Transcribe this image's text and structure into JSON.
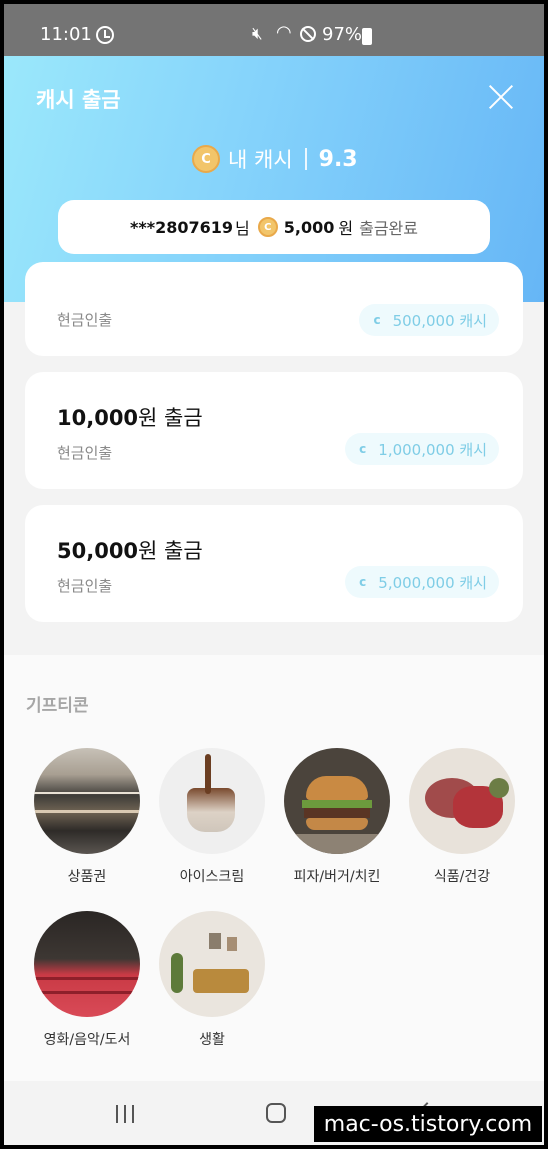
{
  "status_bar": {
    "time": "11:01",
    "battery": "97%"
  },
  "header": {
    "title": "캐시 출금",
    "my_cash_label": "내 캐시",
    "my_cash_value": "9.3",
    "coin_letter": "C"
  },
  "notice": {
    "user": "***2807619",
    "honorific": "님",
    "amount": "5,000",
    "unit": "원",
    "status": "출금완료"
  },
  "withdraw_options": [
    {
      "amount": "",
      "unit": "",
      "label": "현금인출",
      "cost": "500,000 캐시"
    },
    {
      "amount": "10,000",
      "unit": "원 출금",
      "label": "현금인출",
      "cost": "1,000,000 캐시"
    },
    {
      "amount": "50,000",
      "unit": "원 출금",
      "label": "현금인출",
      "cost": "5,000,000 캐시"
    }
  ],
  "pill_coin_letter": "c",
  "gifticon": {
    "title": "기프티콘",
    "categories": [
      {
        "name": "상품권",
        "icon": "storefront-photo"
      },
      {
        "name": "아이스크림",
        "icon": "ice-cream-photo"
      },
      {
        "name": "피자/버거/치킨",
        "icon": "burger-photo"
      },
      {
        "name": "식품/건강",
        "icon": "meat-photo"
      },
      {
        "name": "영화/음악/도서",
        "icon": "cinema-seats-photo"
      },
      {
        "name": "생활",
        "icon": "living-room-photo"
      }
    ]
  },
  "watermark": "mac-os.tistory.com"
}
